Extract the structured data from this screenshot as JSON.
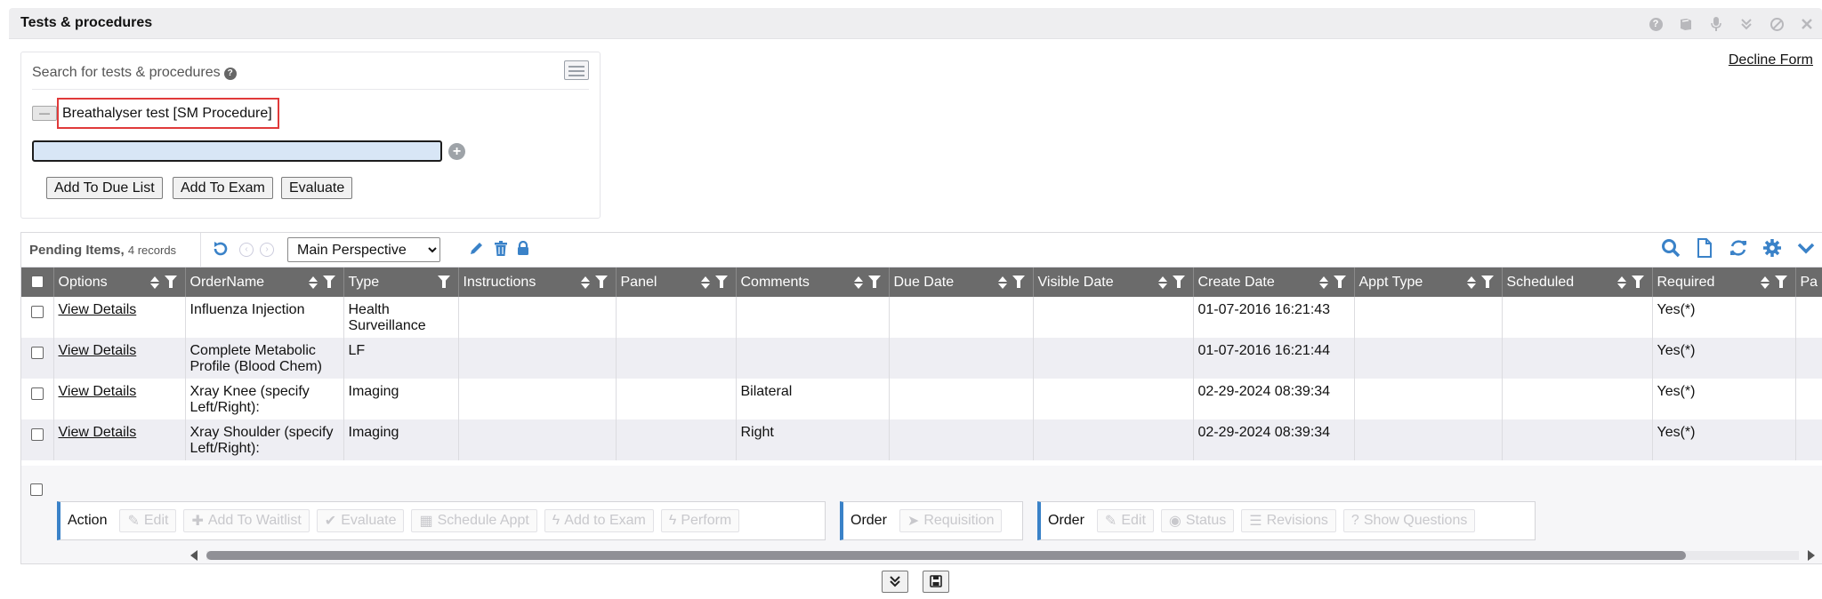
{
  "window": {
    "title": "Tests & procedures",
    "icons": [
      "help-icon",
      "book-icon",
      "microphone-icon",
      "collapse-icon",
      "block-icon",
      "close-icon"
    ]
  },
  "decline_link": "Decline Form",
  "search": {
    "label": "Search for tests & procedures",
    "selected_item": "Breathalyser test [SM Procedure]",
    "input_value": "",
    "buttons": {
      "add_due": "Add To Due List",
      "add_exam": "Add To Exam",
      "evaluate": "Evaluate"
    }
  },
  "grid": {
    "title": "Pending Items,",
    "record_count": "4 records",
    "perspective": "Main Perspective",
    "columns": [
      "Options",
      "OrderName",
      "Type",
      "Instructions",
      "Panel",
      "Comments",
      "Due Date",
      "Visible Date",
      "Create Date",
      "Appt Type",
      "Scheduled",
      "Required",
      "Pa"
    ],
    "rows": [
      {
        "options": "View Details",
        "order_name": "Influenza Injection",
        "type": "Health Surveillance",
        "instructions": "",
        "panel": "",
        "comments": "",
        "due_date": "",
        "visible_date": "",
        "create_date": "01-07-2016 16:21:43",
        "appt_type": "",
        "scheduled": "",
        "required": "Yes(*)"
      },
      {
        "options": "View Details",
        "order_name": "Complete Metabolic Profile (Blood Chem)",
        "type": "LF",
        "instructions": "",
        "panel": "",
        "comments": "",
        "due_date": "",
        "visible_date": "",
        "create_date": "01-07-2016 16:21:44",
        "appt_type": "",
        "scheduled": "",
        "required": "Yes(*)"
      },
      {
        "options": "View Details",
        "order_name": "Xray Knee (specify Left/Right):",
        "type": "Imaging",
        "instructions": "",
        "panel": "",
        "comments": "Bilateral",
        "due_date": "",
        "visible_date": "",
        "create_date": "02-29-2024 08:39:34",
        "appt_type": "",
        "scheduled": "",
        "required": "Yes(*)"
      },
      {
        "options": "View Details",
        "order_name": "Xray Shoulder (specify Left/Right):",
        "type": "Imaging",
        "instructions": "",
        "panel": "",
        "comments": "Right",
        "due_date": "",
        "visible_date": "",
        "create_date": "02-29-2024 08:39:34",
        "appt_type": "",
        "scheduled": "",
        "required": "Yes(*)"
      }
    ],
    "action_groups": [
      {
        "label": "Action",
        "buttons": [
          "Edit",
          "Add To Waitlist",
          "Evaluate",
          "Schedule Appt",
          "Add to Exam",
          "Perform"
        ]
      },
      {
        "label": "Order",
        "buttons": [
          "Requisition"
        ]
      },
      {
        "label": "Order",
        "buttons": [
          "Edit",
          "Status",
          "Revisions",
          "Show Questions"
        ]
      }
    ]
  },
  "accent_color": "#3a82c8"
}
